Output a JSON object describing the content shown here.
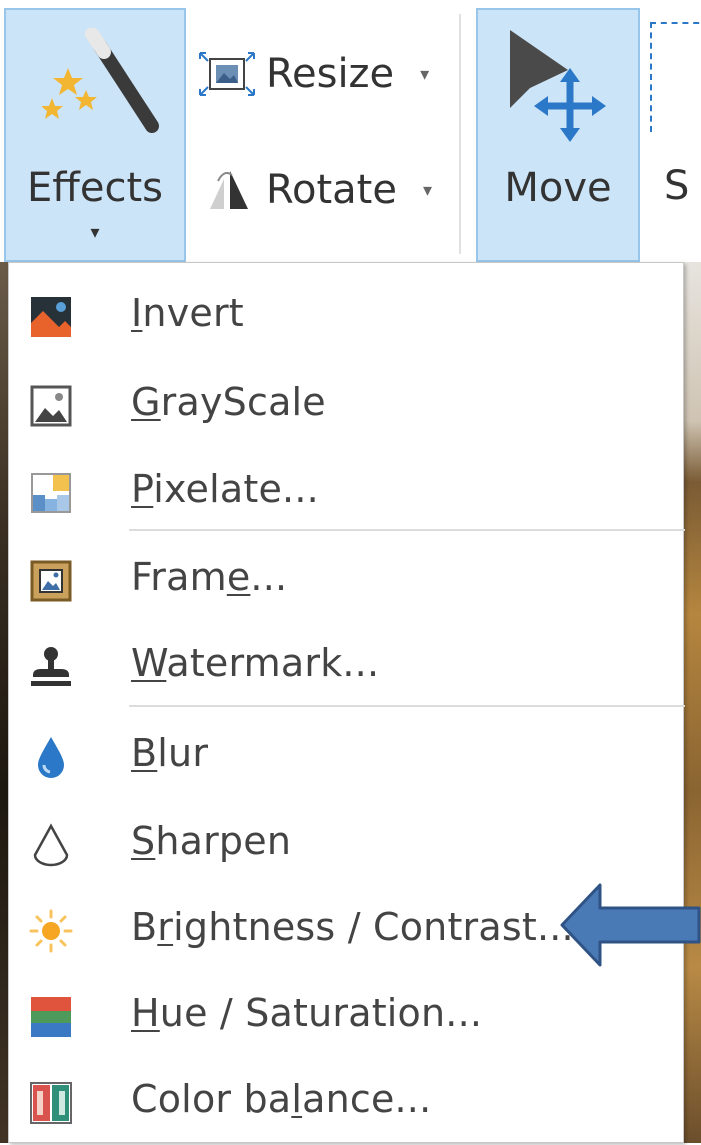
{
  "ribbon": {
    "effects_label": "Effects",
    "effects_caret": "▾",
    "resize_label": "Resize",
    "rotate_label": "Rotate",
    "move_label": "Move",
    "select_label_partial": "S",
    "caret": "▾"
  },
  "menu": {
    "items": [
      {
        "pre": "",
        "u": "I",
        "post": "nvert",
        "icon": "invert-icon"
      },
      {
        "pre": "",
        "u": "G",
        "post": "rayScale",
        "icon": "grayscale-icon"
      },
      {
        "pre": "",
        "u": "P",
        "post": "ixelate...",
        "icon": "pixelate-icon"
      },
      {
        "pre": "Fram",
        "u": "e",
        "post": "...",
        "icon": "frame-icon"
      },
      {
        "pre": "",
        "u": "W",
        "post": "atermark...",
        "icon": "watermark-icon"
      },
      {
        "pre": "",
        "u": "B",
        "post": "lur",
        "icon": "blur-icon"
      },
      {
        "pre": "",
        "u": "S",
        "post": "harpen",
        "icon": "sharpen-icon"
      },
      {
        "pre": "B",
        "u": "r",
        "post": "ightness / Contrast...",
        "icon": "brightness-icon"
      },
      {
        "pre": "",
        "u": "H",
        "post": "ue / Saturation...",
        "icon": "hue-icon"
      },
      {
        "pre": "Color ba",
        "u": "l",
        "post": "ance...",
        "icon": "color-balance-icon"
      }
    ]
  },
  "colors": {
    "ribbon_highlight": "#cce4f7",
    "ribbon_border": "#98c5ea",
    "arrow_fill": "#4a7ab5",
    "arrow_stroke": "#2f5385"
  }
}
